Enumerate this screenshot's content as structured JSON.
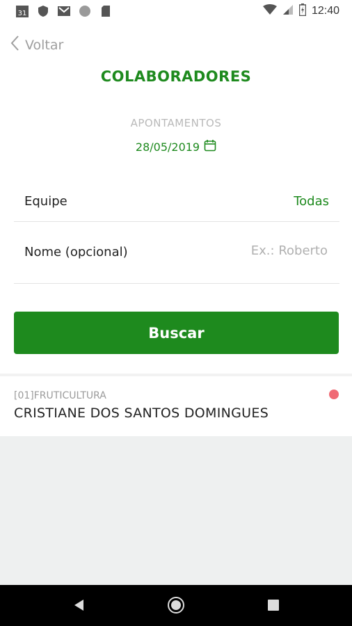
{
  "status_bar": {
    "calendar_day": "31",
    "time": "12:40"
  },
  "header": {
    "back_label": "Voltar",
    "title": "COLABORADORES"
  },
  "section": {
    "subtitle": "APONTAMENTOS",
    "date": "28/05/2019"
  },
  "form": {
    "equipe_label": "Equipe",
    "equipe_value": "Todas",
    "nome_label": "Nome (opcional)",
    "nome_placeholder": "Ex.: Roberto"
  },
  "search_button": "Buscar",
  "results": [
    {
      "code": "[01]FRUTICULTURA",
      "name": "CRISTIANE DOS SANTOS DOMINGUES",
      "status_color": "#f06a74"
    }
  ],
  "colors": {
    "accent": "#1e8a1e",
    "muted": "#b9b9b9",
    "status_red": "#f06a74"
  }
}
